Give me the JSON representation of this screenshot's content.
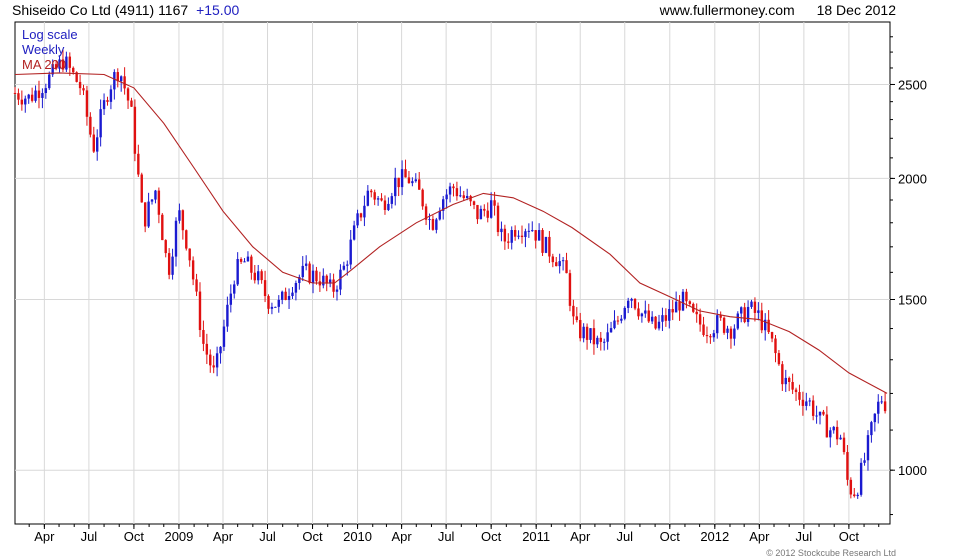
{
  "header": {
    "title": "Shiseido Co Ltd (4911)",
    "price": "1167",
    "change": "+15.00",
    "site": "www.fullermoney.com",
    "date": "18 Dec 2012"
  },
  "legend": {
    "items": [
      {
        "label": "Log scale",
        "color": "#2020c0"
      },
      {
        "label": "Weekly",
        "color": "#2020c0"
      },
      {
        "label": "MA 200",
        "color": "#b22222"
      }
    ]
  },
  "footer": {
    "copyright": "© 2012 Stockcube Research Ltd"
  },
  "chart_data": {
    "type": "candlestick",
    "scale": "log",
    "ylim": [
      880,
      2900
    ],
    "xlim": [
      "2008-02-01",
      "2012-12-24"
    ],
    "y_ticks": [
      1000,
      1500,
      2000,
      2500
    ],
    "y_tick_labels": [
      "1000",
      "1500",
      "2000",
      "2500"
    ],
    "x_ticks": [
      {
        "date": "2008-04-01",
        "label": "Apr"
      },
      {
        "date": "2008-07-01",
        "label": "Jul"
      },
      {
        "date": "2008-10-01",
        "label": "Oct"
      },
      {
        "date": "2009-01-01",
        "label": "2009"
      },
      {
        "date": "2009-04-01",
        "label": "Apr"
      },
      {
        "date": "2009-07-01",
        "label": "Jul"
      },
      {
        "date": "2009-10-01",
        "label": "Oct"
      },
      {
        "date": "2010-01-01",
        "label": "2010"
      },
      {
        "date": "2010-04-01",
        "label": "Apr"
      },
      {
        "date": "2010-07-01",
        "label": "Jul"
      },
      {
        "date": "2010-10-01",
        "label": "Oct"
      },
      {
        "date": "2011-01-01",
        "label": "2011"
      },
      {
        "date": "2011-04-01",
        "label": "Apr"
      },
      {
        "date": "2011-07-01",
        "label": "Jul"
      },
      {
        "date": "2011-10-01",
        "label": "Oct"
      },
      {
        "date": "2012-01-01",
        "label": "2012"
      },
      {
        "date": "2012-04-01",
        "label": "Apr"
      },
      {
        "date": "2012-07-01",
        "label": "Jul"
      },
      {
        "date": "2012-10-01",
        "label": "Oct"
      }
    ],
    "grid": true,
    "colors": {
      "up": "#1a1ad0",
      "down": "#e01010",
      "ma": "#b22222"
    },
    "price_path": [
      [
        "2008-02-01",
        2450
      ],
      [
        "2008-03-01",
        2420
      ],
      [
        "2008-04-15",
        2550
      ],
      [
        "2008-05-10",
        2650
      ],
      [
        "2008-06-15",
        2480
      ],
      [
        "2008-07-10",
        2150
      ],
      [
        "2008-08-10",
        2480
      ],
      [
        "2008-09-01",
        2600
      ],
      [
        "2008-09-25",
        2350
      ],
      [
        "2008-10-20",
        1800
      ],
      [
        "2008-11-15",
        1950
      ],
      [
        "2008-12-10",
        1600
      ],
      [
        "2008-12-31",
        1850
      ],
      [
        "2009-01-20",
        1700
      ],
      [
        "2009-02-20",
        1350
      ],
      [
        "2009-03-15",
        1250
      ],
      [
        "2009-04-05",
        1420
      ],
      [
        "2009-04-25",
        1600
      ],
      [
        "2009-05-15",
        1640
      ],
      [
        "2009-06-10",
        1580
      ],
      [
        "2009-07-01",
        1500
      ],
      [
        "2009-07-25",
        1480
      ],
      [
        "2009-08-20",
        1560
      ],
      [
        "2009-09-15",
        1600
      ],
      [
        "2009-10-15",
        1580
      ],
      [
        "2009-11-10",
        1530
      ],
      [
        "2009-12-05",
        1620
      ],
      [
        "2009-12-31",
        1800
      ],
      [
        "2010-01-25",
        1950
      ],
      [
        "2010-02-20",
        1880
      ],
      [
        "2010-03-20",
        1990
      ],
      [
        "2010-04-15",
        2000
      ],
      [
        "2010-05-10",
        1920
      ],
      [
        "2010-06-01",
        1790
      ],
      [
        "2010-06-20",
        1900
      ],
      [
        "2010-07-15",
        1960
      ],
      [
        "2010-08-10",
        1900
      ],
      [
        "2010-09-05",
        1830
      ],
      [
        "2010-10-01",
        1880
      ],
      [
        "2010-10-25",
        1720
      ],
      [
        "2010-11-20",
        1780
      ],
      [
        "2010-12-20",
        1790
      ],
      [
        "2011-01-20",
        1700
      ],
      [
        "2011-02-15",
        1650
      ],
      [
        "2011-03-05",
        1580
      ],
      [
        "2011-03-20",
        1400
      ],
      [
        "2011-04-15",
        1380
      ],
      [
        "2011-05-15",
        1340
      ],
      [
        "2011-06-15",
        1420
      ],
      [
        "2011-07-10",
        1530
      ],
      [
        "2011-08-05",
        1450
      ],
      [
        "2011-09-01",
        1400
      ],
      [
        "2011-10-01",
        1450
      ],
      [
        "2011-10-25",
        1500
      ],
      [
        "2011-11-20",
        1430
      ],
      [
        "2011-12-15",
        1400
      ],
      [
        "2012-01-10",
        1420
      ],
      [
        "2012-02-05",
        1400
      ],
      [
        "2012-03-10",
        1470
      ],
      [
        "2012-04-01",
        1440
      ],
      [
        "2012-04-25",
        1360
      ],
      [
        "2012-05-20",
        1240
      ],
      [
        "2012-06-15",
        1200
      ],
      [
        "2012-07-10",
        1180
      ],
      [
        "2012-08-05",
        1120
      ],
      [
        "2012-08-25",
        1100
      ],
      [
        "2012-09-15",
        1080
      ],
      [
        "2012-09-30",
        960
      ],
      [
        "2012-10-15",
        950
      ],
      [
        "2012-11-01",
        1020
      ],
      [
        "2012-11-20",
        1120
      ],
      [
        "2012-12-05",
        1190
      ],
      [
        "2012-12-18",
        1167
      ]
    ],
    "ma_path": [
      [
        "2008-02-01",
        2560
      ],
      [
        "2008-05-01",
        2570
      ],
      [
        "2008-08-01",
        2560
      ],
      [
        "2008-10-01",
        2480
      ],
      [
        "2008-12-01",
        2280
      ],
      [
        "2009-02-01",
        2050
      ],
      [
        "2009-04-01",
        1850
      ],
      [
        "2009-06-01",
        1700
      ],
      [
        "2009-08-01",
        1600
      ],
      [
        "2009-10-01",
        1560
      ],
      [
        "2009-11-15",
        1560
      ],
      [
        "2009-12-20",
        1610
      ],
      [
        "2010-02-15",
        1700
      ],
      [
        "2010-05-01",
        1800
      ],
      [
        "2010-07-15",
        1880
      ],
      [
        "2010-09-15",
        1930
      ],
      [
        "2010-11-15",
        1910
      ],
      [
        "2011-01-15",
        1850
      ],
      [
        "2011-03-15",
        1780
      ],
      [
        "2011-06-01",
        1670
      ],
      [
        "2011-08-01",
        1560
      ],
      [
        "2011-10-01",
        1510
      ],
      [
        "2011-12-01",
        1460
      ],
      [
        "2012-02-01",
        1440
      ],
      [
        "2012-04-01",
        1430
      ],
      [
        "2012-06-01",
        1390
      ],
      [
        "2012-08-01",
        1330
      ],
      [
        "2012-10-01",
        1260
      ],
      [
        "2012-12-18",
        1200
      ]
    ]
  }
}
